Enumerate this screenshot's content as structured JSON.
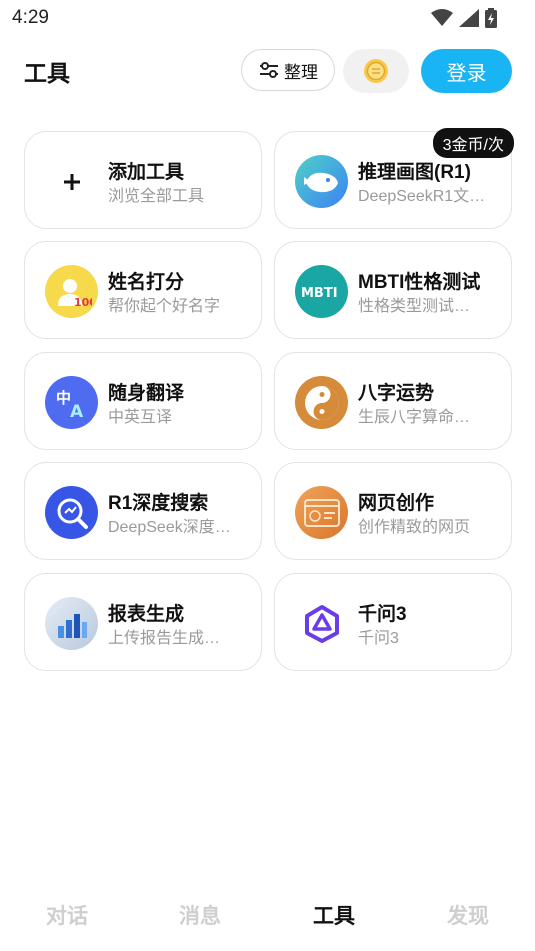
{
  "status_bar": {
    "time": "4:29"
  },
  "header": {
    "title": "工具",
    "organize_label": "整理",
    "login_label": "登录"
  },
  "tools": [
    {
      "name": "添加工具",
      "desc": "浏览全部工具",
      "icon": "plus-icon"
    },
    {
      "name": "推理画图(R1)",
      "desc": "DeepSeekR1文…",
      "icon": "deepseek-whale-icon",
      "badge": "3金币/次"
    },
    {
      "name": "姓名打分",
      "desc": "帮你起个好名字",
      "icon": "name-score-icon"
    },
    {
      "name": "MBTI性格测试",
      "desc": "性格类型测试…",
      "icon": "mbti-icon"
    },
    {
      "name": "随身翻译",
      "desc": "中英互译",
      "icon": "translate-icon"
    },
    {
      "name": "八字运势",
      "desc": "生辰八字算命…",
      "icon": "yin-yang-icon"
    },
    {
      "name": "R1深度搜索",
      "desc": "DeepSeek深度…",
      "icon": "deep-search-icon"
    },
    {
      "name": "网页创作",
      "desc": "创作精致的网页",
      "icon": "web-create-icon"
    },
    {
      "name": "报表生成",
      "desc": "上传报告生成…",
      "icon": "report-chart-icon"
    },
    {
      "name": "千问3",
      "desc": "千问3",
      "icon": "qwen-icon"
    }
  ],
  "bottom_nav": {
    "items": [
      {
        "label": "对话"
      },
      {
        "label": "消息"
      },
      {
        "label": "工具",
        "active": true
      },
      {
        "label": "发现"
      }
    ]
  },
  "colors": {
    "accent": "#19b4f3",
    "badge_bg": "#111111",
    "inactive_nav": "#cfcfcf"
  }
}
